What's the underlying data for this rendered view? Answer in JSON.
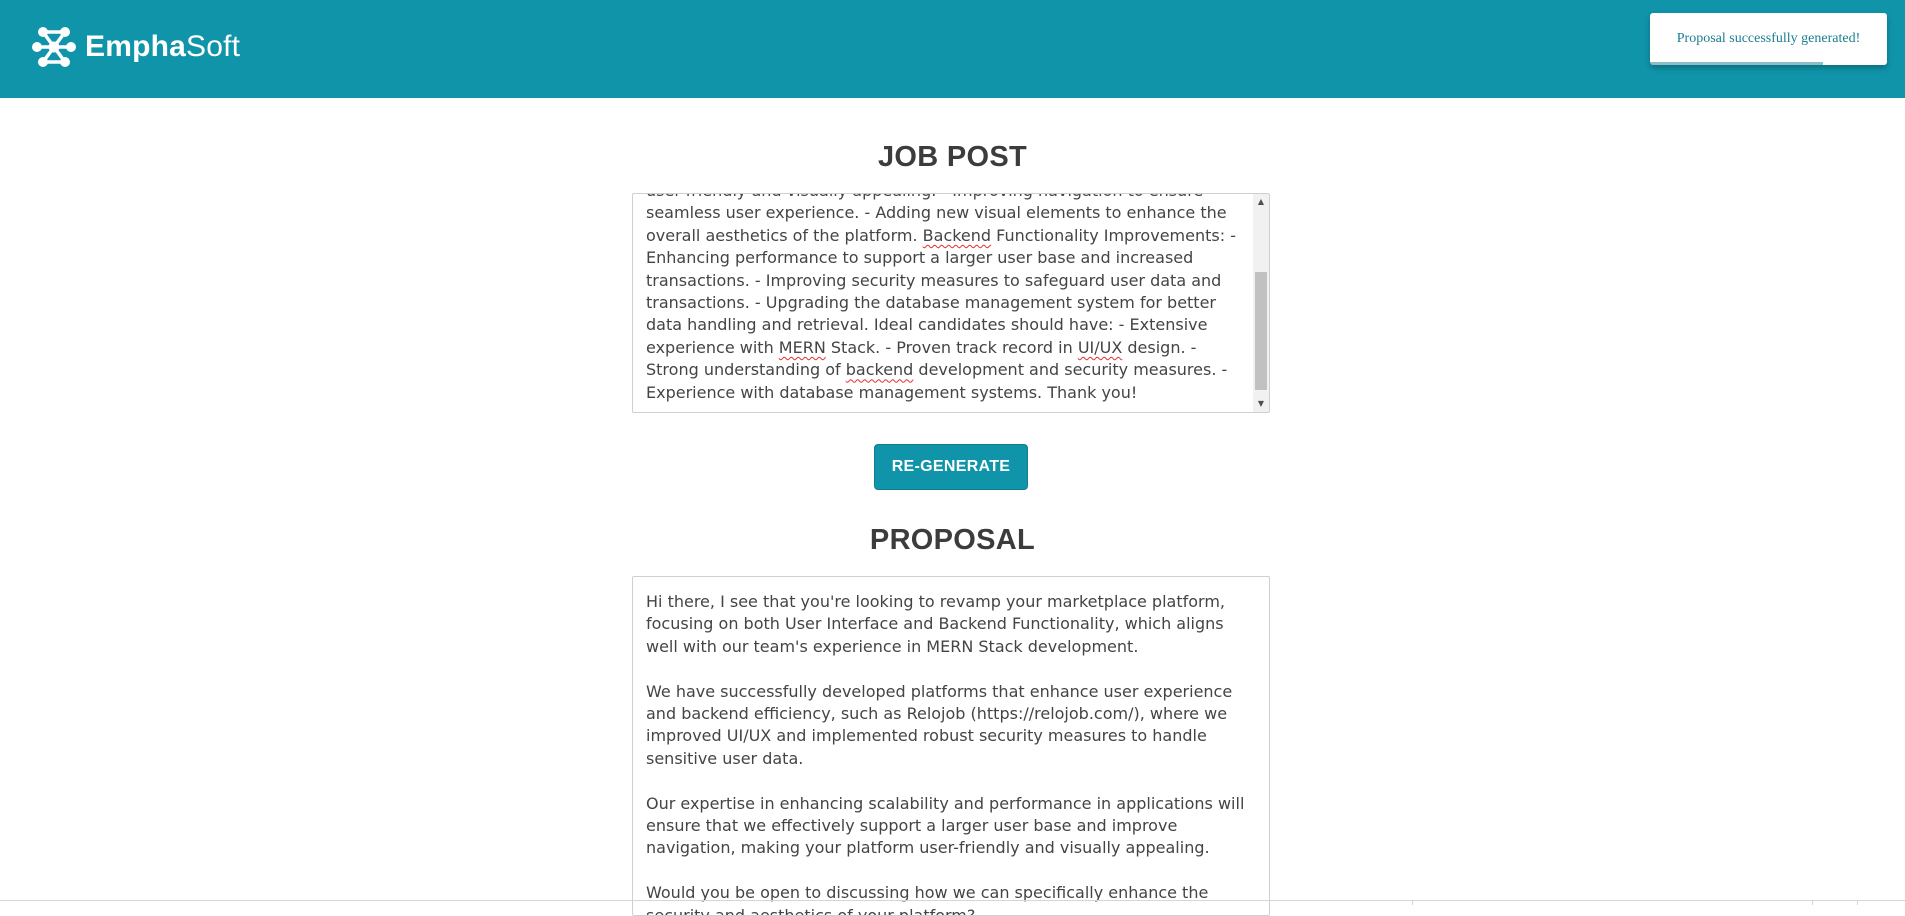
{
  "header": {
    "brand_bold": "Empha",
    "brand_light": "Soft",
    "logo_icon": "molecule-network-icon",
    "background": "#1094a9"
  },
  "toast": {
    "message": "Proposal successfully generated!"
  },
  "job_post": {
    "title": "JOB POST",
    "text_parts": [
      "user-friendly and visually appealing. - Improving navigation to ensure seamless user experience. - Adding new visual elements to enhance the overall aesthetics of the platform. ",
      "Backend",
      " Functionality Improvements: - Enhancing performance to support a larger user base and increased transactions. - Improving security measures to safeguard user data and transactions. - Upgrading the database management system for better data handling and retrieval. Ideal candidates should have: - Extensive experience with ",
      "MERN",
      " Stack. - Proven track record in ",
      "UI/UX",
      " design. - Strong understanding of ",
      "backend",
      " development and security measures. - Experience with database management systems. Thank you!"
    ]
  },
  "regenerate_button": {
    "label": "RE-GENERATE"
  },
  "proposal": {
    "title": "PROPOSAL",
    "paragraphs": [
      "Hi there, I see that you're looking to revamp your marketplace platform, focusing on both User Interface and Backend Functionality, which aligns well with our team's experience in MERN Stack development.",
      "We have successfully developed platforms that enhance user experience and backend efficiency, such as Relojob (https://relojob.com/), where we improved UI/UX and implemented robust security measures to handle sensitive user data.",
      "Our expertise in enhancing scalability and performance in applications will ensure that we effectively support a larger user base and improve navigation, making your platform user-friendly and visually appealing.",
      "Would you be open to discussing how we can specifically enhance the security and aesthetics of your platform?"
    ]
  },
  "colors": {
    "accent": "#1094a9",
    "text": "#3c3c3c",
    "spell_underline": "#e03030"
  }
}
